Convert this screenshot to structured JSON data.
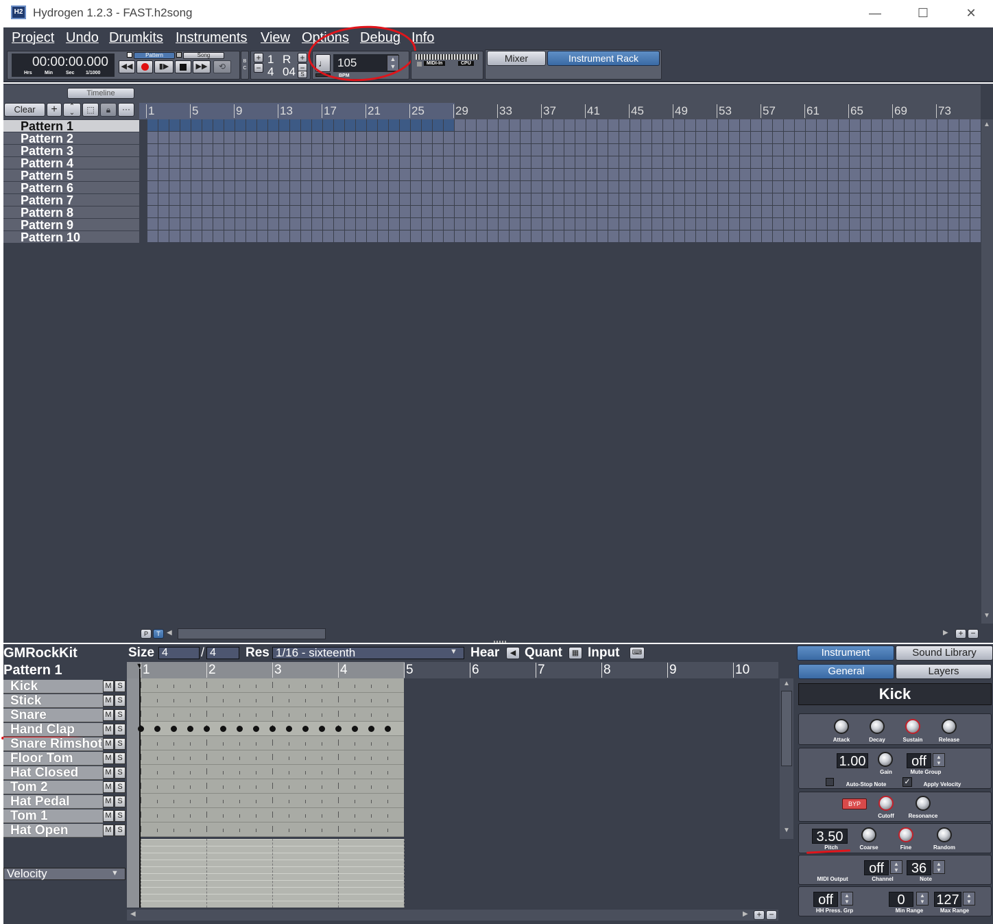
{
  "window": {
    "app_icon": "H2",
    "title": "Hydrogen 1.2.3 - FAST.h2song",
    "controls": {
      "minimize": "—",
      "maximize": "☐",
      "close": "✕"
    }
  },
  "menu": [
    "Project",
    "Undo",
    "Drumkits",
    "Instruments",
    "View",
    "Options",
    "Debug",
    "Info"
  ],
  "toolbar": {
    "time": "00:00:00.000",
    "time_units": [
      "Hrs",
      "Min",
      "Sec",
      "1/1000"
    ],
    "mode_pattern": "Pattern",
    "mode_song": "Song",
    "bc_label": "B C",
    "signature_top": "1",
    "signature_bottom": "4",
    "rubberband_label": "R",
    "rubberband_value": "04",
    "s_label": "S",
    "bpm_value": "105",
    "bpm_label": "BPM",
    "midi_in": "MIDI-In",
    "cpu": "CPU",
    "mixer": "Mixer",
    "instrument_rack": "Instrument Rack"
  },
  "song_editor": {
    "timeline_label": "Timeline",
    "clear_label": "Clear",
    "ruler_numbers": [
      "1",
      "5",
      "9",
      "13",
      "17",
      "21",
      "25",
      "29",
      "33",
      "37",
      "41",
      "45",
      "49",
      "53",
      "57",
      "61",
      "65",
      "69",
      "73"
    ],
    "patterns": [
      "Pattern 1",
      "Pattern 2",
      "Pattern 3",
      "Pattern 4",
      "Pattern 5",
      "Pattern 6",
      "Pattern 7",
      "Pattern 8",
      "Pattern 9",
      "Pattern 10"
    ],
    "pattern1_active_cells": 28,
    "scroll_p": "P",
    "scroll_t": "T"
  },
  "pattern_editor": {
    "drumkit_name": "GMRockKit",
    "pattern_name": "Pattern 1",
    "size_label": "Size",
    "size_a": "4",
    "size_b": "4",
    "res_label": "Res",
    "res_value": "1/16 - sixteenth",
    "hear_label": "Hear",
    "quant_label": "Quant",
    "input_label": "Input",
    "ruler_numbers": [
      "1",
      "2",
      "3",
      "4",
      "5",
      "6",
      "7",
      "8",
      "9",
      "10"
    ],
    "instruments": [
      "Kick",
      "Stick",
      "Snare",
      "Hand Clap",
      "Snare Rimshot",
      "Floor Tom",
      "Hat Closed",
      "Tom 2",
      "Hat Pedal",
      "Tom 1",
      "Hat Open"
    ],
    "mute_label": "M",
    "solo_label": "S",
    "hand_clap_notes": 16,
    "velocity_label": "Velocity"
  },
  "rack": {
    "tab_instrument": "Instrument",
    "tab_sound_library": "Sound Library",
    "tab_general": "General",
    "tab_layers": "Layers",
    "instrument_name": "Kick",
    "adsr_labels": [
      "Attack",
      "Decay",
      "Sustain",
      "Release"
    ],
    "gain_value": "1.00",
    "gain_label": "Gain",
    "mute_group_value": "off",
    "mute_group_label": "Mute Group",
    "auto_stop_label": "Auto-Stop Note",
    "apply_velocity_label": "Apply Velocity",
    "byp_label": "BYP",
    "cutoff_label": "Cutoff",
    "resonance_label": "Resonance",
    "pitch_value": "3.50",
    "pitch_label": "Pitch",
    "coarse_label": "Coarse",
    "fine_label": "Fine",
    "random_label": "Random",
    "midi_output_label": "MIDI Output",
    "channel_value": "off",
    "channel_label": "Channel",
    "note_value": "36",
    "note_label": "Note",
    "hh_value": "off",
    "hh_label": "HH Press. Grp",
    "min_range_value": "0",
    "min_range_label": "Min Range",
    "max_range_value": "127",
    "max_range_label": "Max Range"
  },
  "colors": {
    "background": "#3a3f4b",
    "panel": "#5a5f6c",
    "accent_blue": "#3a6aa4",
    "annotation_red": "#e0151b"
  }
}
